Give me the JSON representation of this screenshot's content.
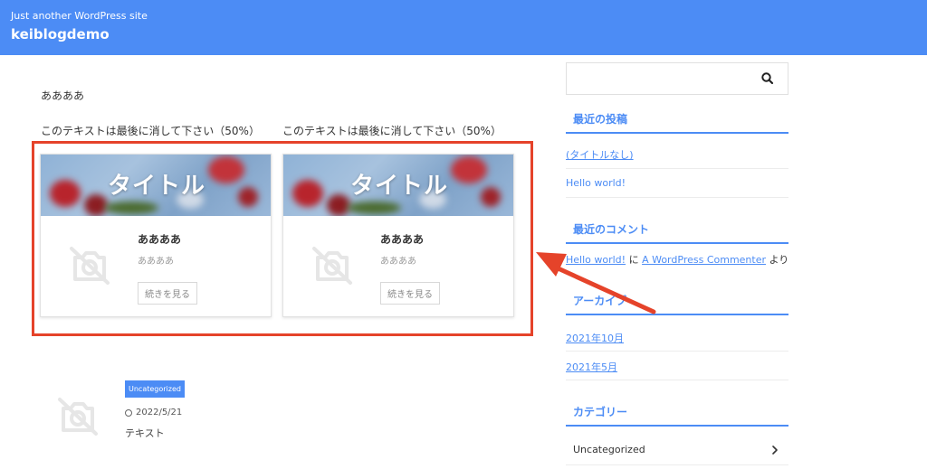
{
  "header": {
    "tagline": "Just another WordPress site",
    "site_title": "keiblogdemo",
    "color": "#4c8cf5"
  },
  "main": {
    "intro_text": "ああああ",
    "columns": [
      {
        "note": "このテキストは最後に消して下さい（50%）",
        "banner_text": "タイトル",
        "title": "ああああ",
        "excerpt": "ああああ",
        "button_label": "続きを見る",
        "thumbnail_icon": "no-image-icon"
      },
      {
        "note": "このテキストは最後に消して下さい（50%）",
        "banner_text": "タイトル",
        "title": "ああああ",
        "excerpt": "ああああ",
        "button_label": "続きを見る",
        "thumbnail_icon": "no-image-icon"
      }
    ],
    "highlight_color": "#e5432a",
    "post": {
      "category": "Uncategorized",
      "date": "2022/5/21",
      "text": "テキスト",
      "thumbnail_icon": "no-image-icon"
    }
  },
  "sidebar": {
    "search": {
      "placeholder": "",
      "icon": "search-icon"
    },
    "recent_posts": {
      "title": "最近の投稿",
      "items": [
        "(タイトルなし)",
        "Hello world!"
      ]
    },
    "recent_comments": {
      "title": "最近のコメント",
      "post_link": "Hello world!",
      "connector": "に",
      "author_link": "A WordPress Commenter",
      "suffix": "より"
    },
    "archives": {
      "title": "アーカイブ",
      "items": [
        "2021年10月",
        "2021年5月"
      ]
    },
    "categories": {
      "title": "カテゴリー",
      "items": [
        "Uncategorized"
      ]
    }
  }
}
